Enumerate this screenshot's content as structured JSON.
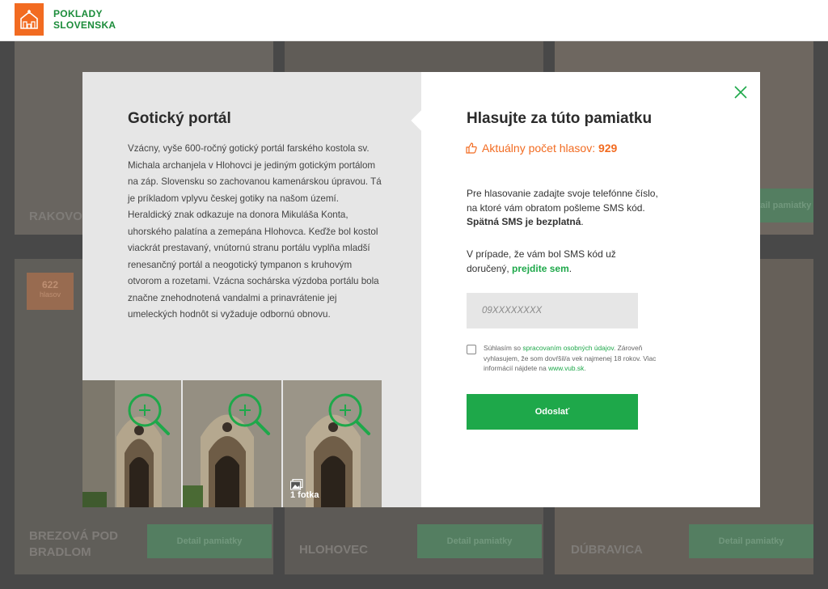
{
  "header": {
    "logo_line1": "POKLADY",
    "logo_line2": "SLOVENSKA",
    "logo_icon": "church-icon",
    "brand_color": "#f26b21",
    "accent_color": "#1ea84a"
  },
  "background": {
    "tiles": [
      {
        "label": "RAKOVO"
      },
      {
        "label": "BREZOVÁ POD BRADLOM",
        "button": "Detail pamiatky"
      },
      {
        "label": "HLOHOVEC",
        "button": "Detail pamiatky"
      },
      {
        "label": "DÚBRAVICA",
        "button": "Detail pamiatky"
      }
    ],
    "top_button": "Detail pamiatky",
    "badge_count": "622",
    "badge_unit": "hlasov"
  },
  "monument": {
    "title": "Gotický portál",
    "description": "Vzácny, vyše 600-ročný gotický portál farského kostola sv. Michala archanjela v Hlohovci je jediným gotickým portálom na záp. Slovensku so zachovanou kamenárskou úpravou. Tá je príkladom vplyvu českej gotiky na našom území. Heraldický znak odkazuje na donora Mikuláša Konta, uhorského palatína a zemepána Hlohovca. Keďže bol kostol viackrát prestavaný, vnútornú stranu portálu vyplňa mladší renesančný portál a neogotický tympanon s kruhovým otvorom a rozetami. Vzácna sochárska výzdoba portálu bola značne znehodnotená vandalmi a prinavrátenie jej umeleckých hodnôt si vyžaduje odbornú obnovu.",
    "photo_count": "1 fotka",
    "photos": [
      {
        "icon": "zoom-in-icon"
      },
      {
        "icon": "zoom-in-icon"
      },
      {
        "icon": "zoom-in-icon"
      }
    ]
  },
  "vote": {
    "title": "Hlasujte za túto pamiatku",
    "count_label": "Aktuálny počet hlasov:",
    "count_value": "929",
    "instructions_1a": "Pre hlasovanie zadajte svoje telefónne číslo, na ktoré vám obratom pošleme SMS kód.",
    "instructions_1b": "Spätná SMS je bezplatná",
    "instructions_1c": ".",
    "instructions_2a": "V prípade, že vám bol SMS kód už doručený,",
    "instructions_2_link": "prejdite sem",
    "instructions_2c": ".",
    "phone_placeholder": "09XXXXXXXX",
    "consent_prefix": "Súhlasím so",
    "consent_link": "spracovaním osobných údajov",
    "consent_middle": ". Zároveň vyhlasujem, že som dovŕšil/a vek najmenej 18 rokov. Viac informácií nájdete na",
    "consent_site": "www.vub.sk",
    "consent_suffix": ".",
    "submit_label": "Odoslať"
  }
}
